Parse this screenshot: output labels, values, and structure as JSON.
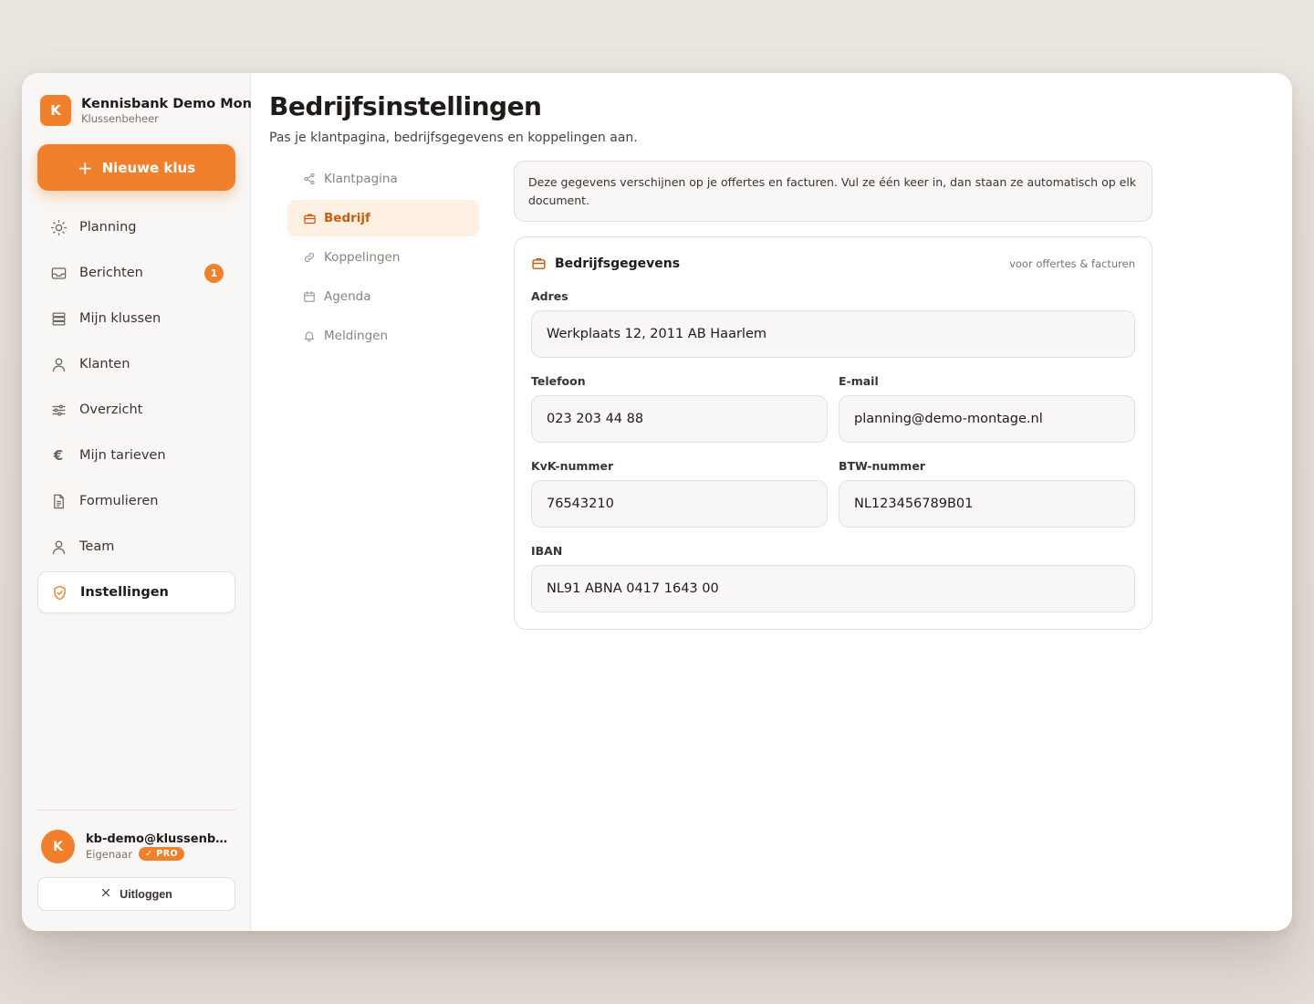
{
  "app": {
    "brand_initial": "K",
    "brand_name": "Kennisbank Demo Montage",
    "brand_sub": "Klussenbeheer",
    "accent_color": "#f0802c"
  },
  "sidebar": {
    "new_button": "Nieuwe klus",
    "items": [
      {
        "label": "Planning",
        "icon": "sun-icon"
      },
      {
        "label": "Berichten",
        "icon": "inbox-icon",
        "badge": "1"
      },
      {
        "label": "Mijn klussen",
        "icon": "stack-icon"
      },
      {
        "label": "Klanten",
        "icon": "user-icon"
      },
      {
        "label": "Overzicht",
        "icon": "sliders-icon"
      },
      {
        "label": "Mijn tarieven",
        "icon": "euro-icon"
      },
      {
        "label": "Formulieren",
        "icon": "document-icon"
      },
      {
        "label": "Team",
        "icon": "user-icon"
      },
      {
        "label": "Instellingen",
        "icon": "shield-check-icon",
        "active": true
      }
    ],
    "user": {
      "initial": "K",
      "email": "kb-demo@klussenbeheer.nl",
      "role": "Eigenaar",
      "plan": "PRO"
    },
    "logout": "Uitloggen"
  },
  "page": {
    "title": "Bedrijfsinstellingen",
    "subtitle": "Pas je klantpagina, bedrijfsgegevens en koppelingen aan."
  },
  "subnav": [
    {
      "label": "Klantpagina",
      "icon": "share-icon"
    },
    {
      "label": "Bedrijf",
      "icon": "briefcase-icon",
      "active": true
    },
    {
      "label": "Koppelingen",
      "icon": "link-icon"
    },
    {
      "label": "Agenda",
      "icon": "calendar-icon"
    },
    {
      "label": "Meldingen",
      "icon": "bell-icon"
    }
  ],
  "notice": "Deze gegevens verschijnen op je offertes en facturen. Vul ze één keer in, dan staan ze automatisch op elk document.",
  "card": {
    "title": "Bedrijfsgegevens",
    "hint": "voor offertes & facturen",
    "fields": {
      "address": {
        "label": "Adres",
        "value": "Werkplaats 12, 2011 AB Haarlem"
      },
      "phone": {
        "label": "Telefoon",
        "value": "023 203 44 88"
      },
      "email": {
        "label": "E-mail",
        "value": "planning@demo-montage.nl"
      },
      "kvk": {
        "label": "KvK-nummer",
        "value": "76543210"
      },
      "btw": {
        "label": "BTW-nummer",
        "value": "NL123456789B01"
      },
      "iban": {
        "label": "IBAN",
        "value": "NL91 ABNA 0417 1643 00"
      }
    }
  }
}
